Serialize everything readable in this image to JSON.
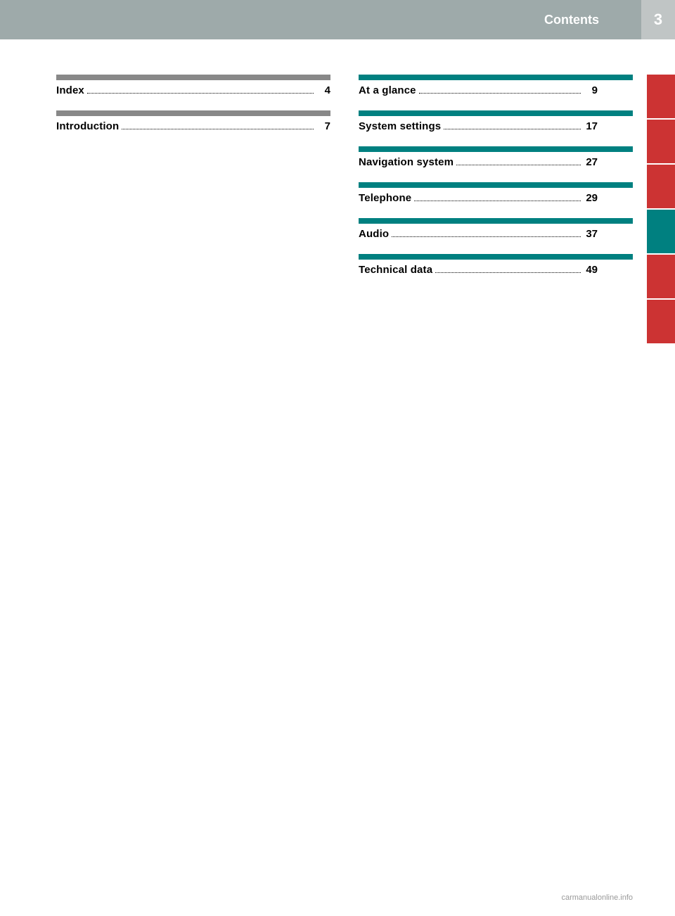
{
  "header": {
    "title": "Contents",
    "page_number": "3",
    "bg_color": "#9eaaaa",
    "page_bg_color": "#b0b8b8"
  },
  "left_column": {
    "entries": [
      {
        "label": "Index",
        "dots": "......................................................",
        "page": "4",
        "bar_color": "gray"
      },
      {
        "label": "Introduction",
        "dots": "..........................................",
        "page": "7",
        "bar_color": "gray"
      }
    ]
  },
  "right_column": {
    "entries": [
      {
        "label": "At a glance",
        "dots": "............................................",
        "page": "9",
        "bar_color": "teal"
      },
      {
        "label": "System settings",
        "dots": "..................................",
        "page": "17",
        "bar_color": "teal"
      },
      {
        "label": "Navigation system",
        "dots": "..............................",
        "page": "27",
        "bar_color": "teal"
      },
      {
        "label": "Telephone",
        "dots": "............................................",
        "page": "29",
        "bar_color": "teal"
      },
      {
        "label": "Audio",
        "dots": "......................................................",
        "page": "37",
        "bar_color": "teal"
      },
      {
        "label": "Technical data",
        "dots": "......................................",
        "page": "49",
        "bar_color": "teal"
      }
    ]
  },
  "sidebar_tabs": [
    {
      "color": "red"
    },
    {
      "color": "red"
    },
    {
      "color": "red"
    },
    {
      "color": "teal"
    },
    {
      "color": "red"
    },
    {
      "color": "red"
    }
  ],
  "watermark": "carmanualonline.info"
}
